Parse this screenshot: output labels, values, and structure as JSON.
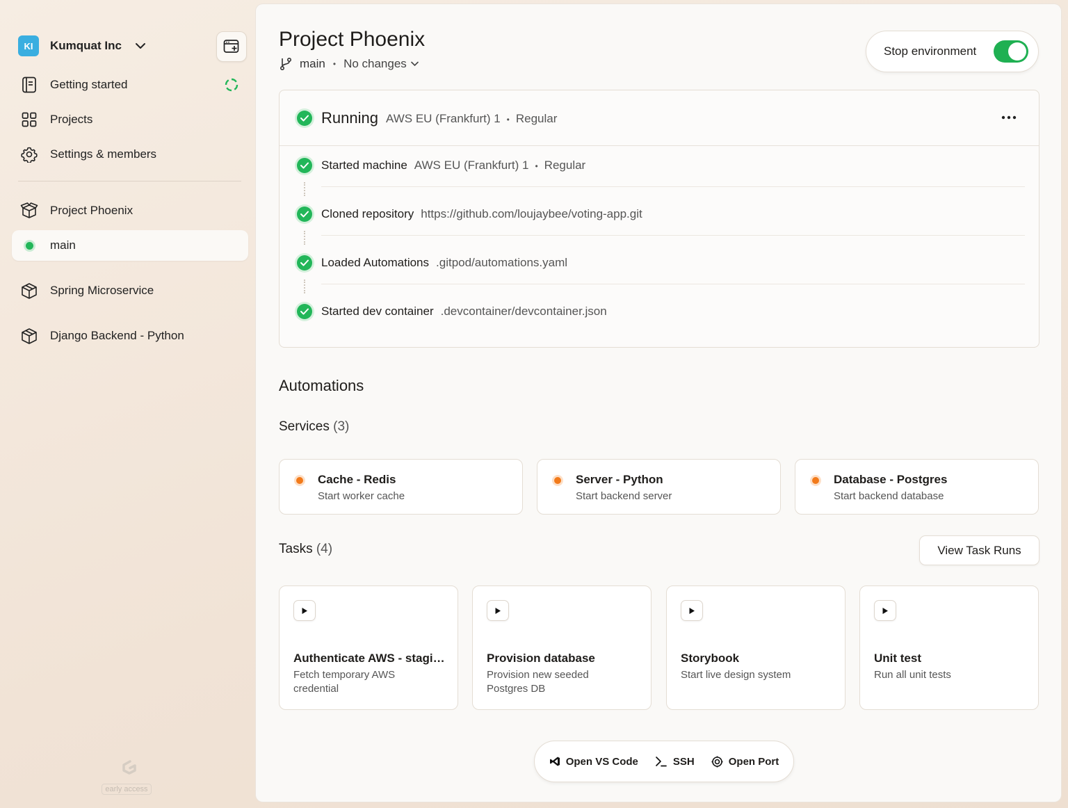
{
  "sidebar": {
    "org": {
      "initials": "KI",
      "name": "Kumquat Inc"
    },
    "nav": {
      "getting_started": "Getting started",
      "projects": "Projects",
      "settings": "Settings & members"
    },
    "projects": [
      {
        "name": "Project Phoenix"
      },
      {
        "name": "main"
      },
      {
        "name": "Spring Microservice"
      },
      {
        "name": "Django Backend - Python"
      }
    ],
    "footer_tag": "early access"
  },
  "header": {
    "title": "Project Phoenix",
    "branch": "main",
    "changes": "No changes",
    "stop_label": "Stop environment",
    "toggle_on": true
  },
  "status": {
    "state": "Running",
    "region": "AWS EU (Frankfurt) 1",
    "tier": "Regular",
    "steps": [
      {
        "label": "Started machine",
        "region": "AWS EU (Frankfurt) 1",
        "tier": "Regular"
      },
      {
        "label": "Cloned repository",
        "value": "https://github.com/loujaybee/voting-app.git"
      },
      {
        "label": "Loaded Automations",
        "value": ".gitpod/automations.yaml"
      },
      {
        "label": "Started dev container",
        "value": ".devcontainer/devcontainer.json"
      }
    ]
  },
  "automations": {
    "heading": "Automations",
    "services_label": "Services",
    "services_count": "(3)",
    "services": [
      {
        "name": "Cache - Redis",
        "desc": "Start worker cache"
      },
      {
        "name": "Server - Python",
        "desc": "Start backend server"
      },
      {
        "name": "Database - Postgres",
        "desc": "Start backend database"
      }
    ],
    "tasks_label": "Tasks",
    "tasks_count": "(4)",
    "view_runs": "View Task Runs",
    "tasks": [
      {
        "name": "Authenticate AWS - staging",
        "desc": "Fetch temporary AWS credential"
      },
      {
        "name": "Provision database",
        "desc": "Provision new seeded Postgres DB"
      },
      {
        "name": "Storybook",
        "desc": "Start live design system"
      },
      {
        "name": "Unit test",
        "desc": "Run all unit tests"
      }
    ]
  },
  "actions": {
    "vscode": "Open VS Code",
    "ssh": "SSH",
    "port": "Open Port"
  },
  "colors": {
    "accent_green": "#22b659",
    "service_orange": "#f27a1a",
    "org_badge": "#3aaee0"
  }
}
